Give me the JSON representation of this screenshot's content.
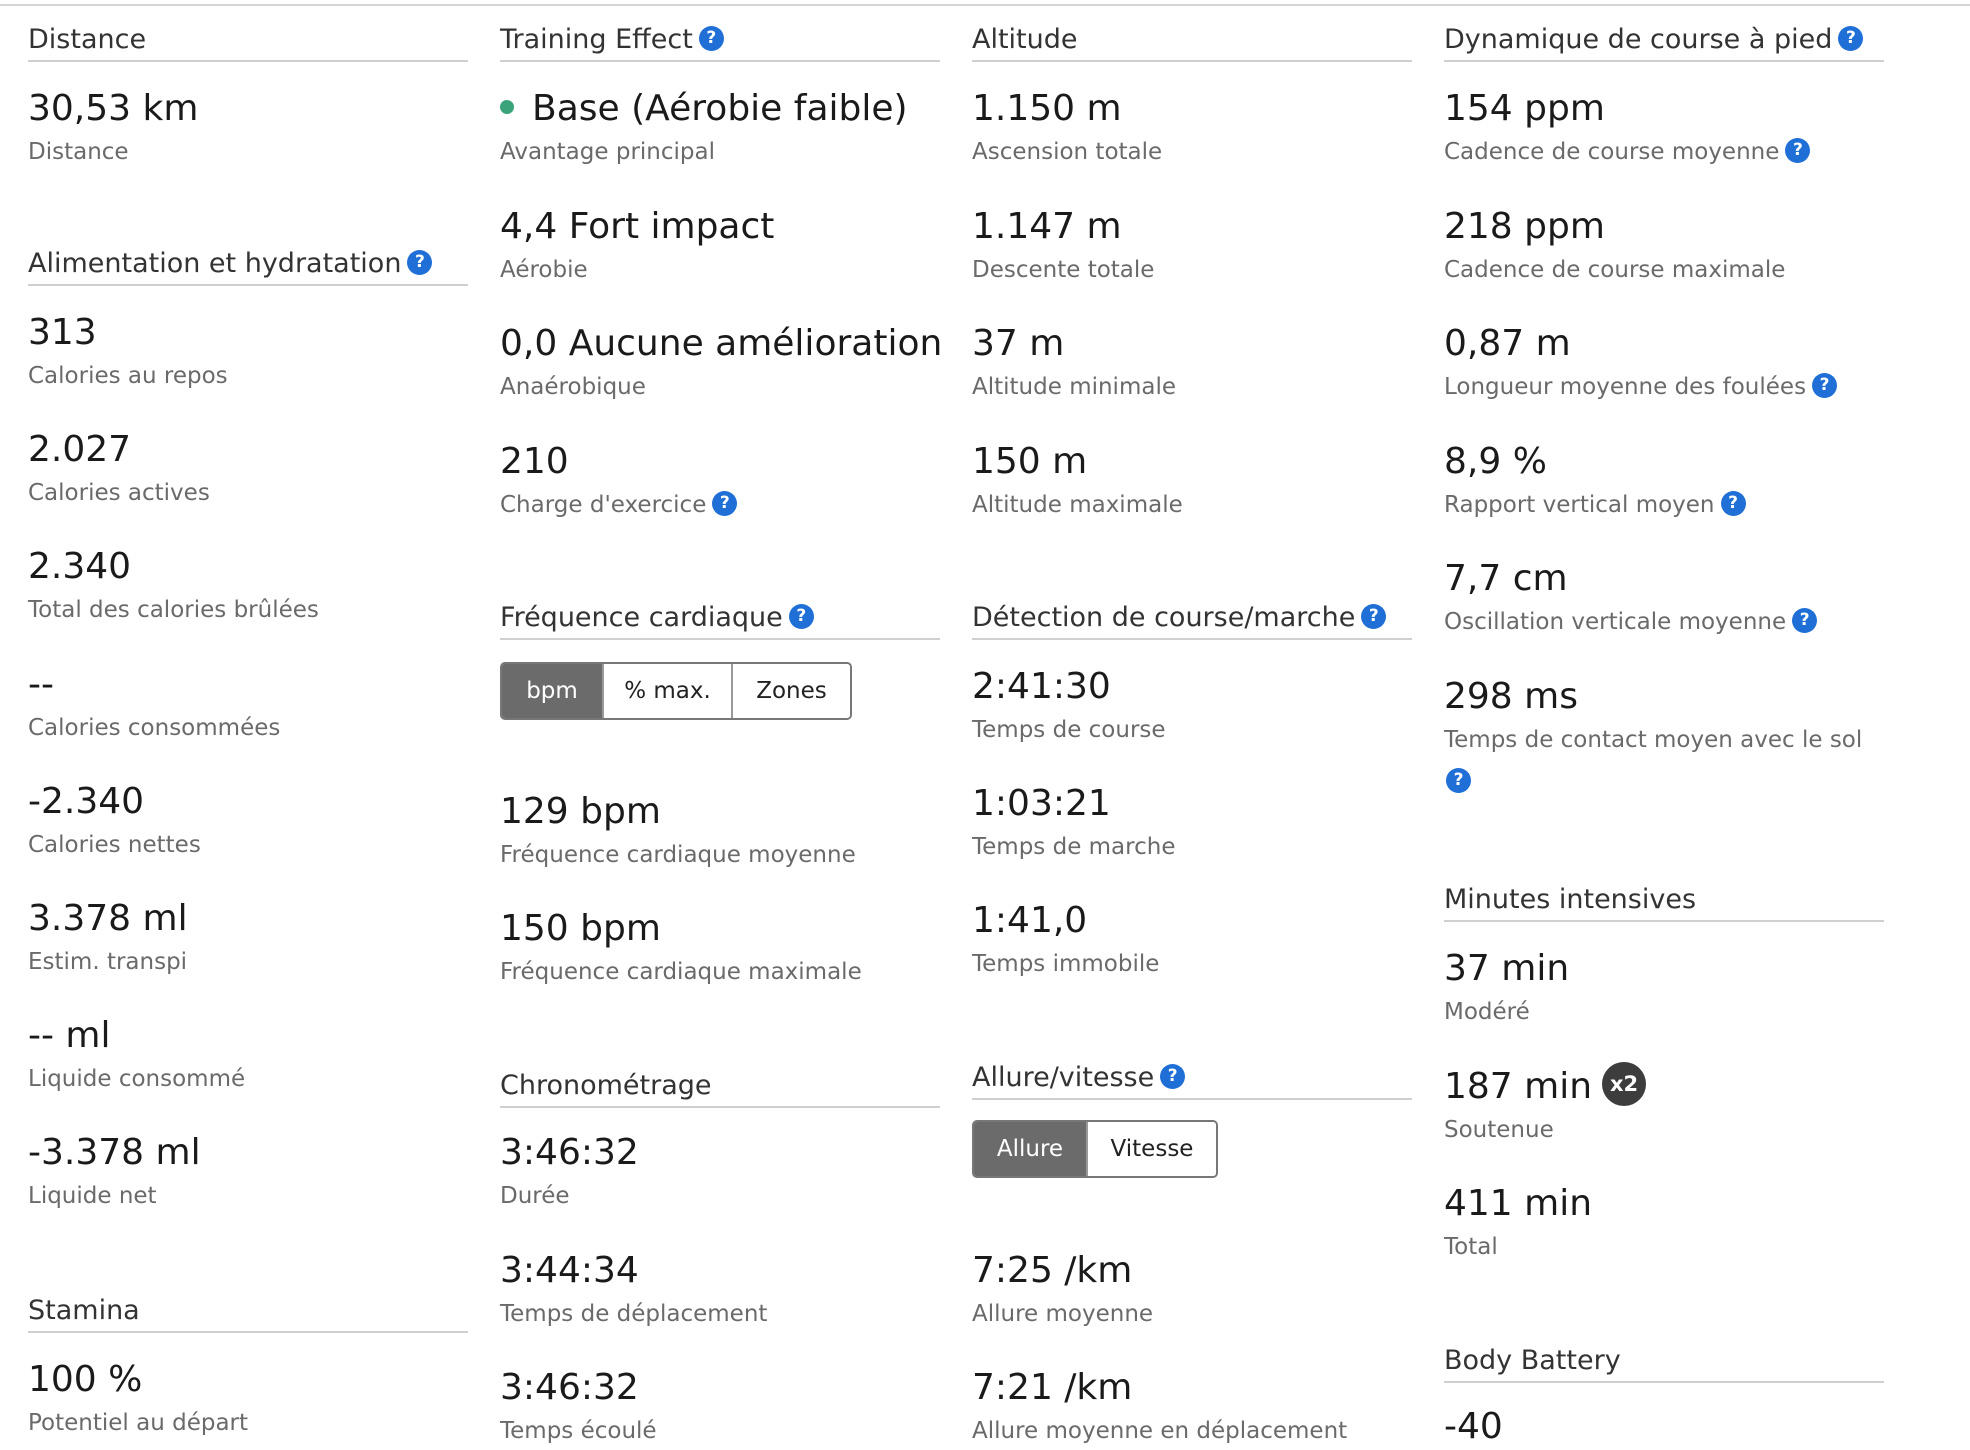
{
  "distance": {
    "title": "Distance",
    "items": [
      {
        "value": "30,53 km",
        "label": "Distance"
      }
    ]
  },
  "nutrition": {
    "title": "Alimentation et hydratation",
    "items": [
      {
        "value": "313",
        "label": "Calories au repos"
      },
      {
        "value": "2.027",
        "label": "Calories actives"
      },
      {
        "value": "2.340",
        "label": "Total des calories brûlées"
      },
      {
        "value": "--",
        "label": "Calories consommées"
      },
      {
        "value": "-2.340",
        "label": "Calories nettes"
      },
      {
        "value": "3.378 ml",
        "label": "Estim. transpi"
      },
      {
        "value": "-- ml",
        "label": "Liquide consommé"
      },
      {
        "value": "-3.378 ml",
        "label": "Liquide net"
      }
    ]
  },
  "stamina": {
    "title": "Stamina",
    "items": [
      {
        "value": "100 %",
        "label": "Potentiel au départ"
      }
    ]
  },
  "training_effect": {
    "title": "Training Effect",
    "items": [
      {
        "value": "Base (Aérobie faible)",
        "label": "Avantage principal",
        "dot_color": "#3aa37a"
      },
      {
        "value": "4,4 Fort impact",
        "label": "Aérobie"
      },
      {
        "value": "0,0 Aucune amélioration",
        "label": "Anaérobique"
      },
      {
        "value": "210",
        "label": "Charge d'exercice"
      }
    ]
  },
  "heart_rate": {
    "title": "Fréquence cardiaque",
    "tabs": [
      "bpm",
      "% max.",
      "Zones"
    ],
    "active_tab": "bpm",
    "items": [
      {
        "value": "129 bpm",
        "label": "Fréquence cardiaque moyenne"
      },
      {
        "value": "150 bpm",
        "label": "Fréquence cardiaque maximale"
      }
    ]
  },
  "timing": {
    "title": "Chronométrage",
    "items": [
      {
        "value": "3:46:32",
        "label": "Durée"
      },
      {
        "value": "3:44:34",
        "label": "Temps de déplacement"
      },
      {
        "value": "3:46:32",
        "label": "Temps écoulé"
      }
    ]
  },
  "altitude": {
    "title": "Altitude",
    "items": [
      {
        "value": "1.150 m",
        "label": "Ascension totale"
      },
      {
        "value": "1.147 m",
        "label": "Descente totale"
      },
      {
        "value": "37 m",
        "label": "Altitude minimale"
      },
      {
        "value": "150 m",
        "label": "Altitude maximale"
      }
    ]
  },
  "run_walk": {
    "title": "Détection de course/marche",
    "items": [
      {
        "value": "2:41:30",
        "label": "Temps de course"
      },
      {
        "value": "1:03:21",
        "label": "Temps de marche"
      },
      {
        "value": "1:41,0",
        "label": "Temps immobile"
      }
    ]
  },
  "pace": {
    "title": "Allure/vitesse",
    "tabs": [
      "Allure",
      "Vitesse"
    ],
    "active_tab": "Allure",
    "items": [
      {
        "value": "7:25 /km",
        "label": "Allure moyenne"
      },
      {
        "value": "7:21 /km",
        "label": "Allure moyenne en déplacement"
      }
    ]
  },
  "running_dynamics": {
    "title": "Dynamique de course à pied",
    "items": [
      {
        "value": "154 ppm",
        "label": "Cadence de course moyenne"
      },
      {
        "value": "218 ppm",
        "label": "Cadence de course maximale"
      },
      {
        "value": "0,87 m",
        "label": "Longueur moyenne des foulées"
      },
      {
        "value": "8,9 %",
        "label": "Rapport vertical moyen"
      },
      {
        "value": "7,7 cm",
        "label": "Oscillation verticale moyenne"
      },
      {
        "value": "298 ms",
        "label": "Temps de contact moyen avec le sol"
      }
    ]
  },
  "intensity": {
    "title": "Minutes intensives",
    "items": [
      {
        "value": "37 min",
        "label": "Modéré"
      },
      {
        "value": "187 min",
        "label": "Soutenue",
        "badge": "x2"
      },
      {
        "value": "411 min",
        "label": "Total"
      }
    ]
  },
  "body_battery": {
    "title": "Body Battery",
    "items": [
      {
        "value": "-40",
        "label": ""
      }
    ]
  },
  "icons": {
    "help": "?"
  },
  "colors": {
    "help": "#1f6fd6",
    "segment_active": "#6b6b6b",
    "badge": "#3d3d3d"
  }
}
